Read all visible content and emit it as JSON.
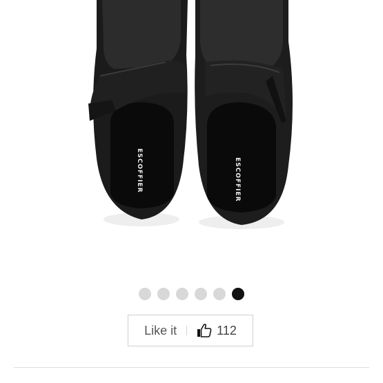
{
  "product": {
    "insole_brand": "ESCOFFIER"
  },
  "gallery": {
    "total_images": 6,
    "active_index": 5
  },
  "like": {
    "label": "Like it",
    "count": "112"
  },
  "icons": {
    "like": "thumbs-up-icon"
  }
}
